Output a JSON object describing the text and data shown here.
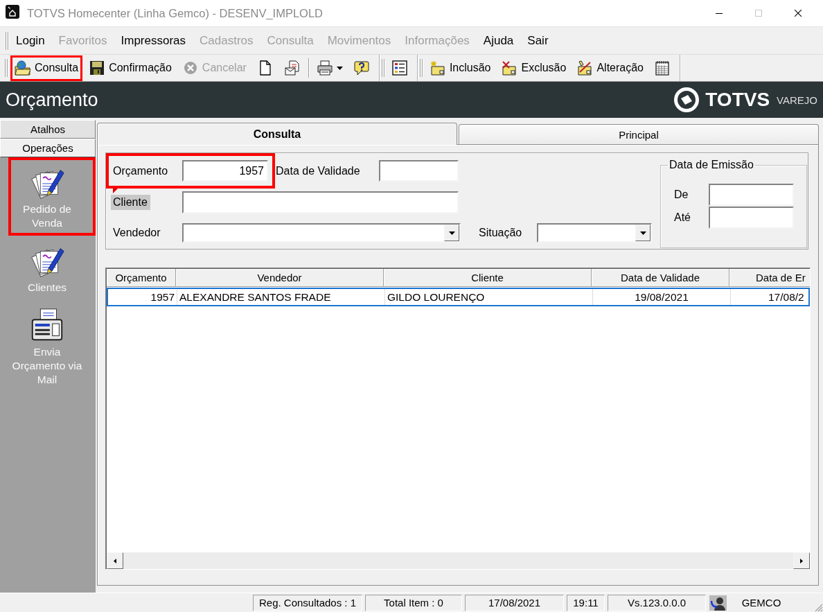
{
  "window": {
    "title": "TOTVS Homecenter (Linha Gemco) - DESENV_IMPLOLD",
    "maximize_disabled": true
  },
  "menu": [
    {
      "label": "Login",
      "disabled": false
    },
    {
      "label": "Favoritos",
      "disabled": true
    },
    {
      "label": "Impressoras",
      "disabled": false
    },
    {
      "label": "Cadastros",
      "disabled": true
    },
    {
      "label": "Consulta",
      "disabled": true
    },
    {
      "label": "Movimentos",
      "disabled": true
    },
    {
      "label": "Informações",
      "disabled": true
    },
    {
      "label": "Ajuda",
      "disabled": false
    },
    {
      "label": "Sair",
      "disabled": false
    }
  ],
  "toolbar_bands": [
    [
      [
        {
          "label": "Consulta",
          "disabled": false,
          "highlighted": true
        },
        {
          "label": "Confirmação",
          "disabled": false,
          "highlighted": false
        },
        {
          "label": "Cancelar",
          "disabled": true,
          "highlighted": false
        },
        {
          "disabled": false,
          "highlighted": false
        },
        {
          "disabled": false,
          "highlighted": false
        }
      ],
      [
        {
          "disabled": false,
          "highlighted": false,
          "dropdown": true
        },
        {
          "disabled": false,
          "highlighted": false
        }
      ]
    ],
    [
      [
        {
          "disabled": false,
          "highlighted": false
        }
      ]
    ],
    [
      [
        {
          "label": "Inclusão",
          "disabled": false,
          "highlighted": false
        },
        {
          "label": "Exclusão",
          "disabled": false,
          "highlighted": false
        },
        {
          "label": "Alteração",
          "disabled": false,
          "highlighted": false
        },
        {
          "disabled": false,
          "highlighted": false
        }
      ]
    ]
  ],
  "header": {
    "title": "Orçamento",
    "brand": "TOTVS",
    "brand_tag": "VAREJO"
  },
  "sidebar": {
    "tabs": [
      {
        "label": "Atalhos",
        "selected": false
      },
      {
        "label": "Operações",
        "selected": true
      }
    ],
    "items": [
      {
        "label": "Pedido de Venda",
        "highlighted": true
      },
      {
        "label": "Clientes",
        "highlighted": false
      },
      {
        "label": "Envia Orçamento via Mail",
        "highlighted": false
      }
    ]
  },
  "form": {
    "tabs": [
      {
        "label": "Consulta",
        "selected": true
      },
      {
        "label": "Principal",
        "selected": false
      }
    ],
    "orcamento": {
      "label": "Orçamento",
      "value": "1957",
      "highlighted": true
    },
    "data_validade": {
      "label": "Data de Validade"
    },
    "cliente": {
      "label": "Cliente",
      "flagged": true
    },
    "vendedor": {
      "label": "Vendedor"
    },
    "situacao": {
      "label": "Situação"
    },
    "data_emissao": {
      "title": "Data de Emissão",
      "fields": [
        {
          "label": "De"
        },
        {
          "label": "Até"
        }
      ]
    }
  },
  "table": {
    "columns": [
      "Orçamento",
      "Vendedor",
      "Cliente",
      "Data de Validade",
      "Data de Er"
    ],
    "rows": [
      {
        "selected": true,
        "cells": [
          "1957",
          "ALEXANDRE SANTOS FRADE",
          "GILDO LOURENÇO",
          "19/08/2021",
          "17/08/2"
        ]
      }
    ]
  },
  "status_bar": {
    "panels": [
      "Reg. Consultados : 1",
      "Total Item : 0",
      "17/08/2021",
      "19:11",
      "Vs.123.0.0.0"
    ],
    "user": "GEMCO"
  }
}
